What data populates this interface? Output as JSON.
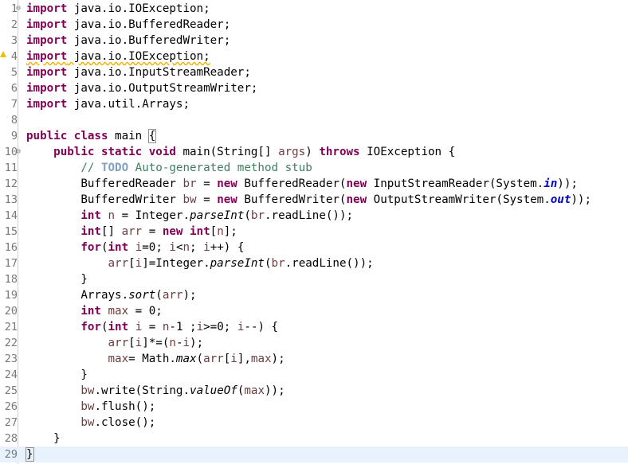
{
  "editor": {
    "current_line": 29,
    "lines": [
      {
        "n": "1",
        "fold": "⊖",
        "warn": false,
        "tokens": [
          {
            "t": "import",
            "c": "kw"
          },
          {
            "t": " java.io.IOException;"
          }
        ]
      },
      {
        "n": "2",
        "tokens": [
          {
            "t": "import",
            "c": "kw"
          },
          {
            "t": " java.io.BufferedReader;"
          }
        ]
      },
      {
        "n": "3",
        "tokens": [
          {
            "t": "import",
            "c": "kw"
          },
          {
            "t": " java.io.BufferedWriter;"
          }
        ]
      },
      {
        "n": "4",
        "warn": true,
        "tokens": [
          {
            "t": "import",
            "c": "kw wavy"
          },
          {
            "t": " java.io.IOException;",
            "c": "wavy"
          }
        ]
      },
      {
        "n": "5",
        "tokens": [
          {
            "t": "import",
            "c": "kw"
          },
          {
            "t": " java.io.InputStreamReader;"
          }
        ]
      },
      {
        "n": "6",
        "tokens": [
          {
            "t": "import",
            "c": "kw"
          },
          {
            "t": " java.io.OutputStreamWriter;"
          }
        ]
      },
      {
        "n": "7",
        "tokens": [
          {
            "t": "import",
            "c": "kw"
          },
          {
            "t": " java.util.Arrays;"
          }
        ]
      },
      {
        "n": "8",
        "tokens": []
      },
      {
        "n": "9",
        "tokens": [
          {
            "t": "public",
            "c": "kw"
          },
          {
            "t": " "
          },
          {
            "t": "class",
            "c": "kw"
          },
          {
            "t": " main "
          },
          {
            "t": "{",
            "c": "brace-box"
          }
        ]
      },
      {
        "n": "10",
        "fold": "⊖",
        "tokens": [
          {
            "t": "    "
          },
          {
            "t": "public",
            "c": "kw"
          },
          {
            "t": " "
          },
          {
            "t": "static",
            "c": "kw"
          },
          {
            "t": " "
          },
          {
            "t": "void",
            "c": "kw"
          },
          {
            "t": " main(String[] "
          },
          {
            "t": "args",
            "c": "var"
          },
          {
            "t": ") "
          },
          {
            "t": "throws",
            "c": "kw"
          },
          {
            "t": " IOException {"
          }
        ]
      },
      {
        "n": "11",
        "tokens": [
          {
            "t": "        "
          },
          {
            "t": "// ",
            "c": "cm"
          },
          {
            "t": "TODO",
            "c": "todo"
          },
          {
            "t": " Auto-generated method stub",
            "c": "cm"
          }
        ]
      },
      {
        "n": "12",
        "tokens": [
          {
            "t": "        BufferedReader "
          },
          {
            "t": "br",
            "c": "var"
          },
          {
            "t": " = "
          },
          {
            "t": "new",
            "c": "kw"
          },
          {
            "t": " BufferedReader("
          },
          {
            "t": "new",
            "c": "kw"
          },
          {
            "t": " InputStreamReader(System."
          },
          {
            "t": "in",
            "c": "fld"
          },
          {
            "t": "));"
          }
        ]
      },
      {
        "n": "13",
        "tokens": [
          {
            "t": "        BufferedWriter "
          },
          {
            "t": "bw",
            "c": "var"
          },
          {
            "t": " = "
          },
          {
            "t": "new",
            "c": "kw"
          },
          {
            "t": " BufferedWriter("
          },
          {
            "t": "new",
            "c": "kw"
          },
          {
            "t": " OutputStreamWriter(System."
          },
          {
            "t": "out",
            "c": "fld"
          },
          {
            "t": "));"
          }
        ]
      },
      {
        "n": "14",
        "tokens": [
          {
            "t": "        "
          },
          {
            "t": "int",
            "c": "kw"
          },
          {
            "t": " "
          },
          {
            "t": "n",
            "c": "var"
          },
          {
            "t": " = Integer."
          },
          {
            "t": "parseInt",
            "c": "st"
          },
          {
            "t": "("
          },
          {
            "t": "br",
            "c": "var"
          },
          {
            "t": ".readLine());"
          }
        ]
      },
      {
        "n": "15",
        "tokens": [
          {
            "t": "        "
          },
          {
            "t": "int",
            "c": "kw"
          },
          {
            "t": "[] "
          },
          {
            "t": "arr",
            "c": "var"
          },
          {
            "t": " = "
          },
          {
            "t": "new",
            "c": "kw"
          },
          {
            "t": " "
          },
          {
            "t": "int",
            "c": "kw"
          },
          {
            "t": "["
          },
          {
            "t": "n",
            "c": "var"
          },
          {
            "t": "];"
          }
        ]
      },
      {
        "n": "16",
        "tokens": [
          {
            "t": "        "
          },
          {
            "t": "for",
            "c": "kw"
          },
          {
            "t": "("
          },
          {
            "t": "int",
            "c": "kw"
          },
          {
            "t": " "
          },
          {
            "t": "i",
            "c": "var"
          },
          {
            "t": "=0; "
          },
          {
            "t": "i",
            "c": "var"
          },
          {
            "t": "<"
          },
          {
            "t": "n",
            "c": "var"
          },
          {
            "t": "; "
          },
          {
            "t": "i",
            "c": "var"
          },
          {
            "t": "++) {"
          }
        ]
      },
      {
        "n": "17",
        "tokens": [
          {
            "t": "            "
          },
          {
            "t": "arr",
            "c": "var"
          },
          {
            "t": "["
          },
          {
            "t": "i",
            "c": "var"
          },
          {
            "t": "]=Integer."
          },
          {
            "t": "parseInt",
            "c": "st"
          },
          {
            "t": "("
          },
          {
            "t": "br",
            "c": "var"
          },
          {
            "t": ".readLine());"
          }
        ]
      },
      {
        "n": "18",
        "tokens": [
          {
            "t": "        }"
          }
        ]
      },
      {
        "n": "19",
        "tokens": [
          {
            "t": "        Arrays."
          },
          {
            "t": "sort",
            "c": "st"
          },
          {
            "t": "("
          },
          {
            "t": "arr",
            "c": "var"
          },
          {
            "t": ");"
          }
        ]
      },
      {
        "n": "20",
        "tokens": [
          {
            "t": "        "
          },
          {
            "t": "int",
            "c": "kw"
          },
          {
            "t": " "
          },
          {
            "t": "max",
            "c": "var"
          },
          {
            "t": " = 0;"
          }
        ]
      },
      {
        "n": "21",
        "tokens": [
          {
            "t": "        "
          },
          {
            "t": "for",
            "c": "kw"
          },
          {
            "t": "("
          },
          {
            "t": "int",
            "c": "kw"
          },
          {
            "t": " "
          },
          {
            "t": "i",
            "c": "var"
          },
          {
            "t": " = "
          },
          {
            "t": "n",
            "c": "var"
          },
          {
            "t": "-1 ;"
          },
          {
            "t": "i",
            "c": "var"
          },
          {
            "t": ">=0; "
          },
          {
            "t": "i",
            "c": "var"
          },
          {
            "t": "--) {"
          }
        ]
      },
      {
        "n": "22",
        "tokens": [
          {
            "t": "            "
          },
          {
            "t": "arr",
            "c": "var"
          },
          {
            "t": "["
          },
          {
            "t": "i",
            "c": "var"
          },
          {
            "t": "]*=("
          },
          {
            "t": "n",
            "c": "var"
          },
          {
            "t": "-"
          },
          {
            "t": "i",
            "c": "var"
          },
          {
            "t": ");"
          }
        ]
      },
      {
        "n": "23",
        "tokens": [
          {
            "t": "            "
          },
          {
            "t": "max",
            "c": "var"
          },
          {
            "t": "= Math."
          },
          {
            "t": "max",
            "c": "st"
          },
          {
            "t": "("
          },
          {
            "t": "arr",
            "c": "var"
          },
          {
            "t": "["
          },
          {
            "t": "i",
            "c": "var"
          },
          {
            "t": "],"
          },
          {
            "t": "max",
            "c": "var"
          },
          {
            "t": ");"
          }
        ]
      },
      {
        "n": "24",
        "tokens": [
          {
            "t": "        }"
          }
        ]
      },
      {
        "n": "25",
        "tokens": [
          {
            "t": "        "
          },
          {
            "t": "bw",
            "c": "var"
          },
          {
            "t": ".write(String."
          },
          {
            "t": "valueOf",
            "c": "st"
          },
          {
            "t": "("
          },
          {
            "t": "max",
            "c": "var"
          },
          {
            "t": "));"
          }
        ]
      },
      {
        "n": "26",
        "tokens": [
          {
            "t": "        "
          },
          {
            "t": "bw",
            "c": "var"
          },
          {
            "t": ".flush();"
          }
        ]
      },
      {
        "n": "27",
        "tokens": [
          {
            "t": "        "
          },
          {
            "t": "bw",
            "c": "var"
          },
          {
            "t": ".close();"
          }
        ]
      },
      {
        "n": "28",
        "tokens": [
          {
            "t": "    }"
          }
        ]
      },
      {
        "n": "29",
        "caret": true,
        "tokens": [
          {
            "t": "}",
            "c": "brace-box"
          }
        ]
      }
    ]
  }
}
